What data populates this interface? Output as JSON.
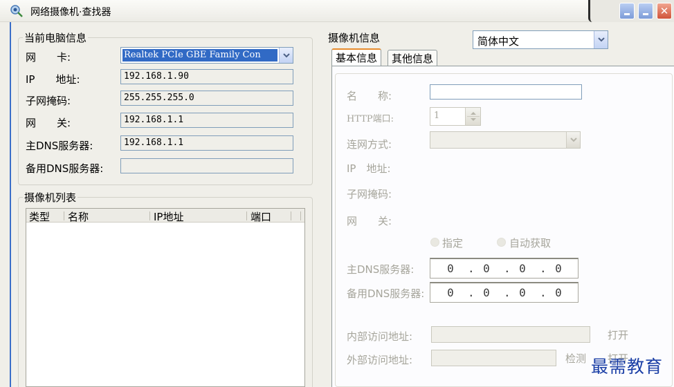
{
  "window": {
    "title": "网络摄像机·查找器",
    "icons": [
      "camera-search-icon",
      "minimize-icon",
      "maximize-icon",
      "close-icon"
    ]
  },
  "pc_info": {
    "legend": "当前电脑信息",
    "nic_label": "网　　卡:",
    "nic_value": "Realtek PCIe GBE Family Con",
    "ip_label": "IP　　地址:",
    "ip_value": "192.168.1.90",
    "mask_label": "子网掩码:",
    "mask_value": "255.255.255.0",
    "gateway_label": "网　　关:",
    "gateway_value": "192.168.1.1",
    "dns1_label": "主DNS服务器:",
    "dns1_value": "192.168.1.1",
    "dns2_label": "备用DNS服务器:",
    "dns2_value": ""
  },
  "camera_list": {
    "legend": "摄像机列表",
    "columns": [
      "类型",
      "名称",
      "IP地址",
      "端口"
    ]
  },
  "camera_info": {
    "legend": "摄像机信息",
    "language": "简体中文",
    "tabs": [
      "基本信息",
      "其他信息"
    ],
    "name_label": "名　　称:",
    "name_value": "",
    "http_label": "HTTP端口:",
    "http_value": "1",
    "mode_label": "连网方式:",
    "ip_label": "IP　地址:",
    "mask_label": "子网掩码:",
    "gateway_label": "网　　关:",
    "radio_manual": "指定",
    "radio_auto": "自动获取",
    "dns1_label": "主DNS服务器:",
    "dns1_octets": [
      "0",
      "0",
      "0",
      "0"
    ],
    "dns2_label": "备用DNS服务器:",
    "dns2_octets": [
      "0",
      "0",
      "0",
      "0"
    ],
    "inner_label": "内部访问地址:",
    "inner_open": "打开",
    "outer_label": "外部访问地址:",
    "outer_check": "检测",
    "outer_open": "打开"
  },
  "watermark": "最需教育",
  "colors": {
    "title_accent": "#3a6ec8",
    "selection": "#316ac5",
    "disabled_text": "#a6a59b",
    "tab_highlight": "#e68b2c",
    "watermark": "#1b3fa6"
  }
}
